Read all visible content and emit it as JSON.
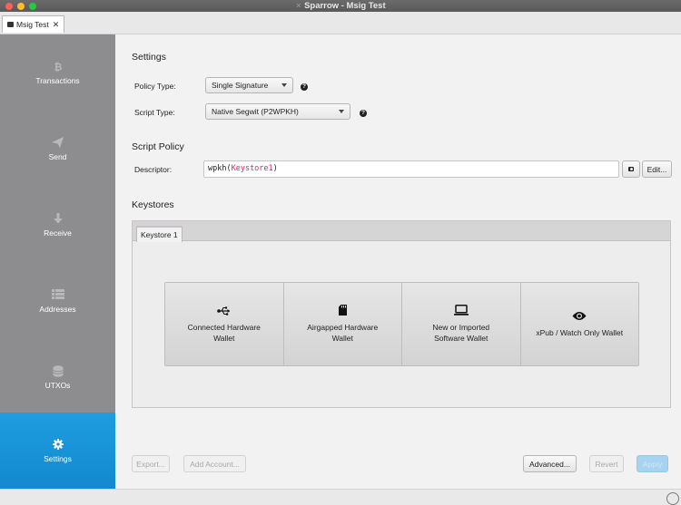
{
  "window": {
    "title": "Sparrow - Msig Test",
    "tab_label": "Msig Test",
    "tab_close": "✕"
  },
  "sidebar": {
    "items": [
      {
        "label": "Transactions",
        "icon": "bitcoin-icon"
      },
      {
        "label": "Send",
        "icon": "send-icon"
      },
      {
        "label": "Receive",
        "icon": "arrow-down-icon"
      },
      {
        "label": "Addresses",
        "icon": "list-icon"
      },
      {
        "label": "UTXOs",
        "icon": "coins-icon"
      },
      {
        "label": "Settings",
        "icon": "gear-icon",
        "active": true
      }
    ]
  },
  "settings": {
    "heading": "Settings",
    "policy_type_label": "Policy Type:",
    "policy_type_value": "Single Signature",
    "script_type_label": "Script Type:",
    "script_type_value": "Native Segwit (P2WPKH)"
  },
  "script_policy": {
    "heading": "Script Policy",
    "descriptor_label": "Descriptor:",
    "descriptor_prefix": "wpkh(",
    "descriptor_keystore": "Keystore1",
    "descriptor_suffix": ")",
    "edit_label": "Edit..."
  },
  "keystores": {
    "heading": "Keystores",
    "tab_label": "Keystore 1",
    "types": [
      {
        "label": "Connected Hardware Wallet",
        "icon": "usb-icon"
      },
      {
        "label": "Airgapped Hardware Wallet",
        "icon": "sd-card-icon"
      },
      {
        "label": "New or Imported Software Wallet",
        "icon": "laptop-icon"
      },
      {
        "label": "xPub / Watch Only Wallet",
        "icon": "eye-icon"
      }
    ]
  },
  "footer": {
    "export_label": "Export...",
    "add_account_label": "Add Account...",
    "advanced_label": "Advanced...",
    "revert_label": "Revert",
    "apply_label": "Apply"
  },
  "colors": {
    "sidebar_bg": "#8d8d8f",
    "sidebar_active": "#1389cf",
    "descriptor_keystore": "#d8266b"
  }
}
